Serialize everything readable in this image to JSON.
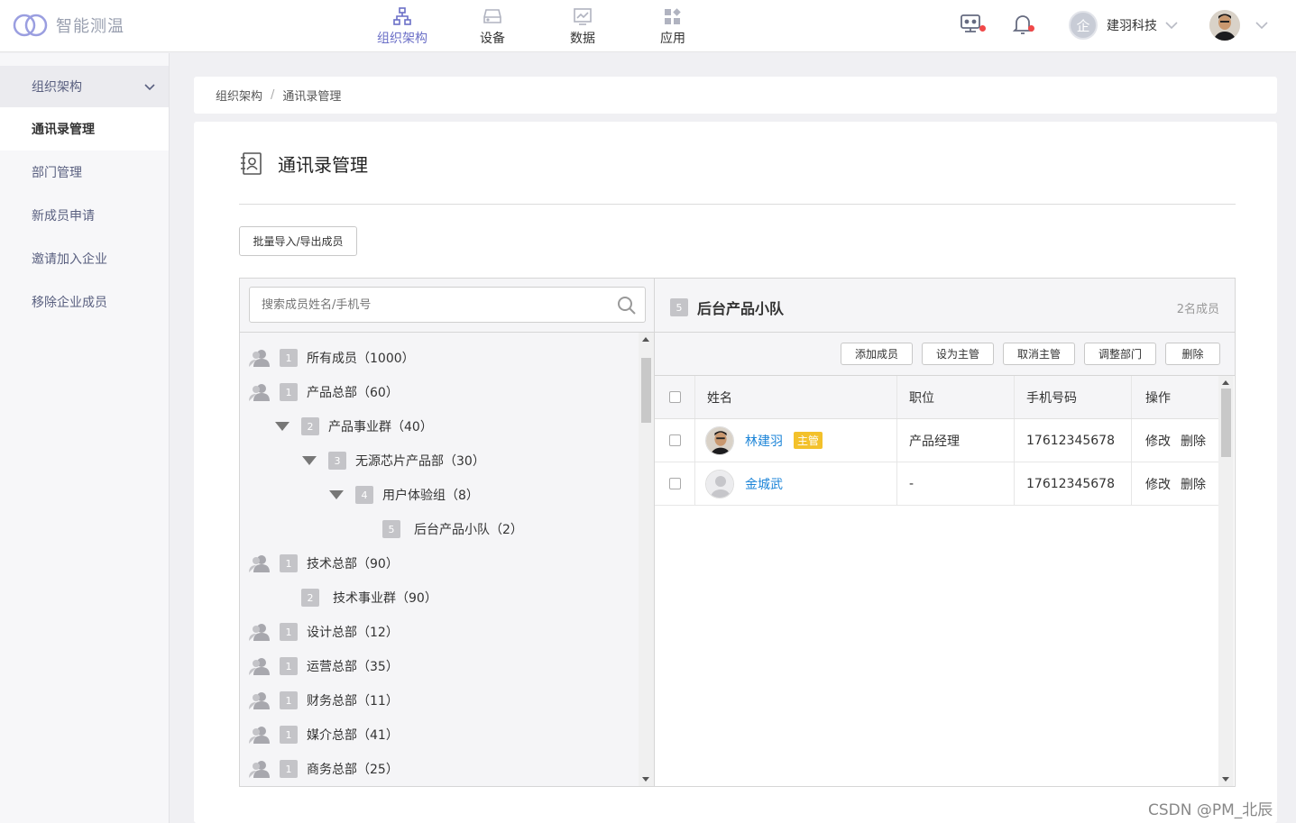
{
  "app": {
    "logo_text": "智能测温"
  },
  "nav": [
    {
      "label": "组织架构",
      "icon": "org-chart-icon",
      "active": true
    },
    {
      "label": "设备",
      "icon": "device-icon",
      "active": false
    },
    {
      "label": "数据",
      "icon": "chart-icon",
      "active": false
    },
    {
      "label": "应用",
      "icon": "apps-icon",
      "active": false
    }
  ],
  "header": {
    "company_name": "建羽科技",
    "company_avatar_char": "企"
  },
  "sidebar": {
    "group_label": "组织架构",
    "items": [
      {
        "label": "通讯录管理",
        "active": true
      },
      {
        "label": "部门管理"
      },
      {
        "label": "新成员申请"
      },
      {
        "label": "邀请加入企业"
      },
      {
        "label": "移除企业成员"
      }
    ]
  },
  "breadcrumb": {
    "root": "组织架构",
    "sep": "/",
    "current": "通讯录管理"
  },
  "page": {
    "title": "通讯录管理",
    "import_button": "批量导入/导出成员"
  },
  "search": {
    "placeholder": "搜索成员姓名/手机号"
  },
  "tree": [
    {
      "level": "1",
      "label": "所有成员（1000）"
    },
    {
      "level": "1",
      "label": "产品总部（60）"
    },
    {
      "level": "2",
      "label": "产品事业群（40）"
    },
    {
      "level": "3",
      "label": "无源芯片产品部（30）"
    },
    {
      "level": "4",
      "label": "用户体验组（8）"
    },
    {
      "level": "5",
      "label": "后台产品小队（2）"
    },
    {
      "level": "1",
      "label": "技术总部（90）"
    },
    {
      "level": "2",
      "label": "技术事业群（90）"
    },
    {
      "level": "1",
      "label": "设计总部（12）"
    },
    {
      "level": "1",
      "label": "运营总部（35）"
    },
    {
      "level": "1",
      "label": "财务总部（11）"
    },
    {
      "level": "1",
      "label": "媒介总部（41）"
    },
    {
      "level": "1",
      "label": "商务总部（25）"
    }
  ],
  "detail": {
    "level": "5",
    "title": "后台产品小队",
    "member_count": "2名成员",
    "toolbar": [
      "添加成员",
      "设为主管",
      "取消主管",
      "调整部门",
      "删除"
    ],
    "columns": {
      "name": "姓名",
      "position": "职位",
      "phone": "手机号码",
      "ops": "操作"
    },
    "rows": [
      {
        "name": "林建羽",
        "tag": "主管",
        "position": "产品经理",
        "phone": "17612345678",
        "edit": "修改",
        "delete": "删除"
      },
      {
        "name": "金城武",
        "tag": "",
        "position": "-",
        "phone": "17612345678",
        "edit": "修改",
        "delete": "删除"
      }
    ]
  },
  "watermark": "CSDN @PM_北辰",
  "colors": {
    "accent": "#6b6fc7",
    "link": "#1d85d8",
    "tag": "#f3c12b",
    "badge_dot": "#f04848"
  }
}
